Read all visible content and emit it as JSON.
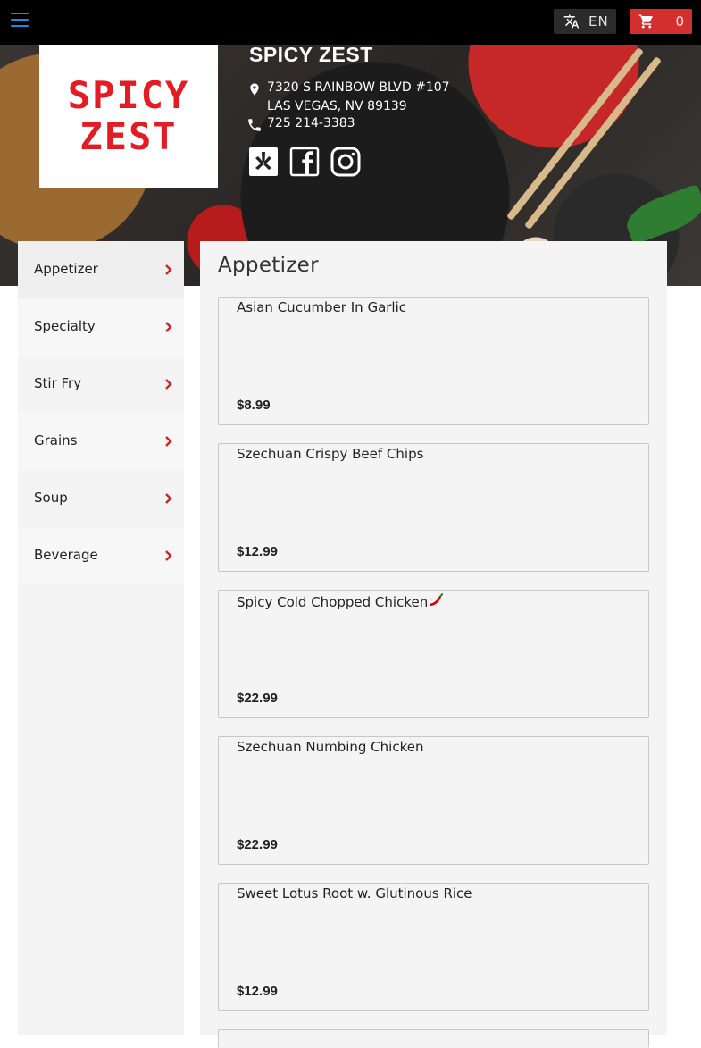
{
  "topbar": {
    "menu_icon": "hamburger-menu-icon",
    "language": {
      "icon": "translate-icon",
      "label": "EN"
    },
    "cart": {
      "icon": "cart-icon",
      "count": "0"
    }
  },
  "restaurant": {
    "logo_line1": "SPICY",
    "logo_line2": "ZEST",
    "name": "SPICY ZEST",
    "address_line1": "7320 S RAINBOW BLVD #107",
    "address_line2": "LAS VEGAS, NV 89139",
    "phone": "725 214-3383",
    "social": [
      "yelp-icon",
      "facebook-icon",
      "instagram-icon"
    ]
  },
  "categories": [
    {
      "label": "Appetizer"
    },
    {
      "label": "Specialty"
    },
    {
      "label": "Stir Fry"
    },
    {
      "label": "Grains"
    },
    {
      "label": "Soup"
    },
    {
      "label": "Beverage"
    }
  ],
  "menu": {
    "section_title": "Appetizer",
    "items": [
      {
        "name": "Asian Cucumber In Garlic",
        "price": "$8.99",
        "spicy": false
      },
      {
        "name": "Szechuan Crispy Beef Chips",
        "price": "$12.99",
        "spicy": false
      },
      {
        "name": "Spicy Cold Chopped Chicken",
        "price": "$22.99",
        "spicy": true
      },
      {
        "name": "Szechuan Numbing Chicken",
        "price": "$22.99",
        "spicy": false
      },
      {
        "name": "Sweet Lotus Root w. Glutinous Rice",
        "price": "$12.99",
        "spicy": false
      }
    ]
  },
  "colors": {
    "accent_red": "#d32f2f",
    "menu_icon_blue": "#1e88e5",
    "logo_red": "#e31b23"
  }
}
